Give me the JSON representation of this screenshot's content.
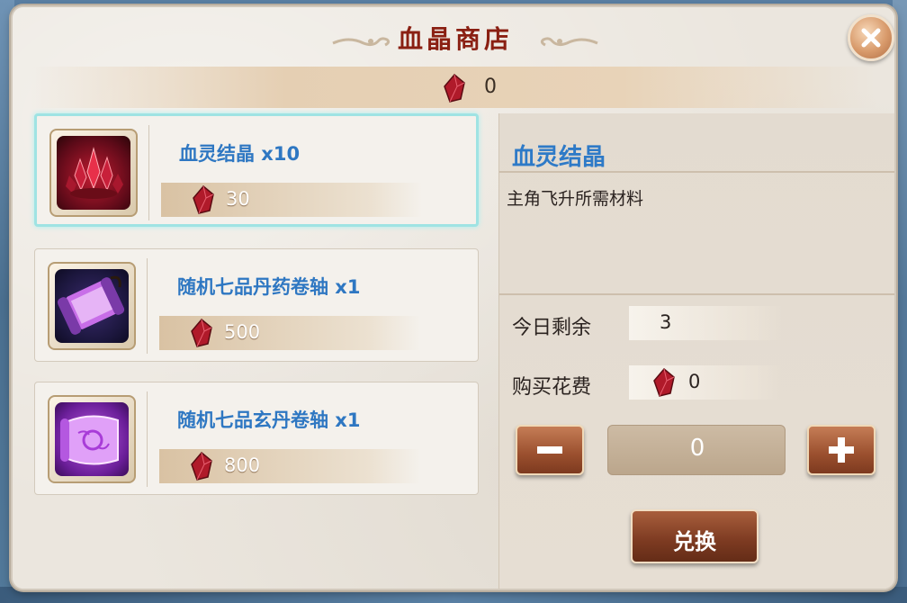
{
  "shop": {
    "title": "血晶商店",
    "balance": "0"
  },
  "items": [
    {
      "name": "血灵结晶 x10",
      "price": "30",
      "icon": "blood-crystal-icon"
    },
    {
      "name": "随机七品丹药卷轴 x1",
      "price": "500",
      "icon": "pill-scroll-icon"
    },
    {
      "name": "随机七品玄丹卷轴 x1",
      "price": "800",
      "icon": "mystic-scroll-icon"
    }
  ],
  "detail": {
    "title": "血灵结晶",
    "description": "主角飞升所需材料",
    "remaining_label": "今日剩余",
    "remaining_value": "3",
    "cost_label": "购买花费",
    "cost_value": "0",
    "quantity": "0",
    "exchange_label": "兑换"
  },
  "colors": {
    "title": "#8a1f12",
    "item_name": "#2e77c2",
    "selected_border": "#9fe3e3",
    "button": "#8a4428"
  }
}
